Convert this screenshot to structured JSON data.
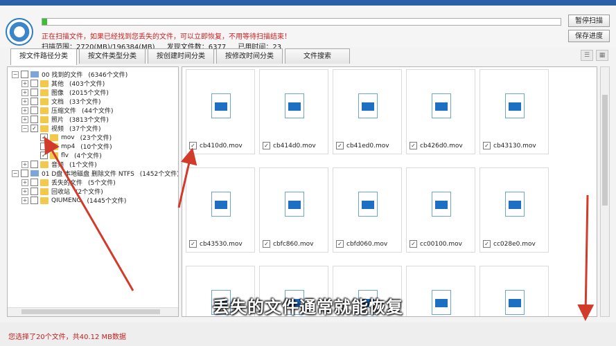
{
  "status": {
    "message": "正在扫描文件，如果已经找到您丢失的文件，可以立即恢复，不用等待扫描结束！",
    "scan_range": "扫描范围：2720(MB)/196384(MB)",
    "found_files": "发现文件数：6377",
    "elapsed": "已用时间：23",
    "progress": 0.01
  },
  "buttons": {
    "pause": "暂停扫描",
    "save": "保存进度"
  },
  "tabs": [
    "按文件路径分类",
    "按文件类型分类",
    "按创建时间分类",
    "按修改时间分类",
    "文件搜索"
  ],
  "tree": [
    {
      "label": "00 找到的文件",
      "count": "(6346个文件)",
      "level": 0,
      "exp": "−",
      "type": "drive"
    },
    {
      "label": "其他",
      "count": "(403个文件)",
      "level": 1,
      "exp": "+",
      "type": "folder"
    },
    {
      "label": "图像",
      "count": "(2015个文件)",
      "level": 1,
      "exp": "+",
      "type": "folder"
    },
    {
      "label": "文档",
      "count": "(33个文件)",
      "level": 1,
      "exp": "+",
      "type": "folder"
    },
    {
      "label": "压缩文件",
      "count": "(44个文件)",
      "level": 1,
      "exp": "+",
      "type": "folder"
    },
    {
      "label": "照片",
      "count": "(3813个文件)",
      "level": 1,
      "exp": "+",
      "type": "folder"
    },
    {
      "label": "视频",
      "count": "(37个文件)",
      "level": 1,
      "exp": "−",
      "type": "folder",
      "checked": true
    },
    {
      "label": "mov",
      "count": "(23个文件)",
      "level": 2,
      "exp": "",
      "type": "folder",
      "checked": true
    },
    {
      "label": "mp4",
      "count": "(10个文件)",
      "level": 2,
      "exp": "",
      "type": "folder"
    },
    {
      "label": "flv",
      "count": "(4个文件)",
      "level": 2,
      "exp": "",
      "type": "folder",
      "checked": true
    },
    {
      "label": "音频",
      "count": "(1个文件)",
      "level": 1,
      "exp": "+",
      "type": "folder"
    },
    {
      "label": "01 D盘 本地磁盘 删除文件 NTFS",
      "count": "(1452个文件)",
      "level": 0,
      "exp": "−",
      "type": "drive"
    },
    {
      "label": "丢失的文件",
      "count": "(5个文件)",
      "level": 1,
      "exp": "+",
      "type": "folder"
    },
    {
      "label": "回收站",
      "count": "(2个文件)",
      "level": 1,
      "exp": "+",
      "type": "folder"
    },
    {
      "label": "QIUMENG",
      "count": "(1445个文件)",
      "level": 1,
      "exp": "+",
      "type": "folder"
    }
  ],
  "files": [
    "cb410d0.mov",
    "cb414d0.mov",
    "cb41ed0.mov",
    "cb426d0.mov",
    "cb43130.mov",
    "cb43530.mov",
    "cbfc860.mov",
    "cbfd060.mov",
    "cc00100.mov",
    "cc028e0.mov",
    "",
    "",
    "",
    "",
    ""
  ],
  "footer": "您选择了20个文件，共40.12 MB数据",
  "subtitle": "丢失的文件通常就能恢复",
  "colors": {
    "arrow": "#d23a2a",
    "accent": "#1c6fc2",
    "warning": "#d02020"
  }
}
